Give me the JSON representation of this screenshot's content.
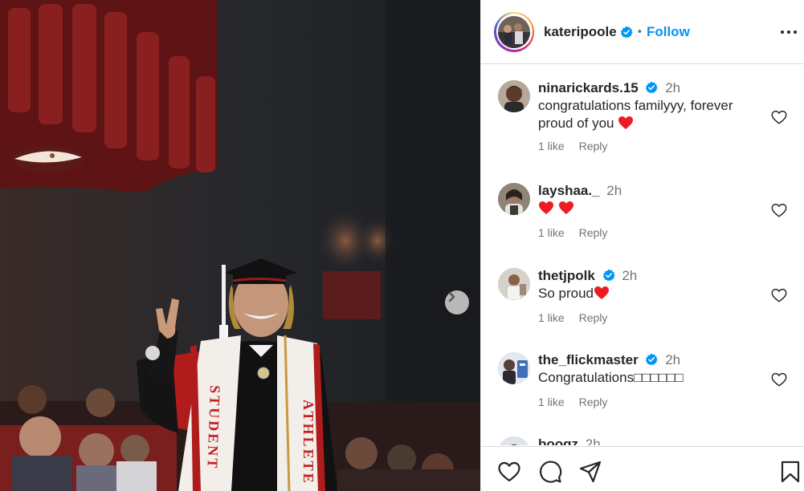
{
  "photo": {
    "sash_left_text": "STUDENT",
    "sash_right_text": "ATHLETE"
  },
  "post": {
    "username": "kateripoole",
    "follow_label": "Follow",
    "dot": "•"
  },
  "comments": [
    {
      "username": "ninarickards.15",
      "time": "2h",
      "text": "congratulations familyyy, forever proud of you",
      "likes": "1 like",
      "reply": "Reply",
      "verified": true,
      "hearts": 1
    },
    {
      "username": "layshaa._",
      "time": "2h",
      "text": "",
      "likes": "1 like",
      "reply": "Reply",
      "verified": false,
      "hearts": 2
    },
    {
      "username": "thetjpolk",
      "time": "2h",
      "text": "So proud",
      "likes": "1 like",
      "reply": "Reply",
      "verified": true,
      "hearts": 1
    },
    {
      "username": "the_flickmaster",
      "time": "2h",
      "text": "Congratulations□□□□□□",
      "likes": "1 like",
      "reply": "Reply",
      "verified": true,
      "hearts": 0
    },
    {
      "username": "boogz",
      "time": "2h"
    }
  ],
  "colors": {
    "accent": "#0095f6",
    "verified": "#0095f6",
    "heart": "#ed1c24",
    "muted": "#737373",
    "text": "#262626",
    "divider": "#dbdbdb"
  },
  "icons": {
    "header": [
      "more-options-icon",
      "verified-badge-icon"
    ],
    "photo": [
      "chevron-right-icon"
    ],
    "comment": [
      "heart-outline-icon",
      "red-heart-emoji"
    ],
    "actions": [
      "heart-outline-icon",
      "comment-bubble-icon",
      "share-send-icon",
      "bookmark-icon"
    ]
  }
}
